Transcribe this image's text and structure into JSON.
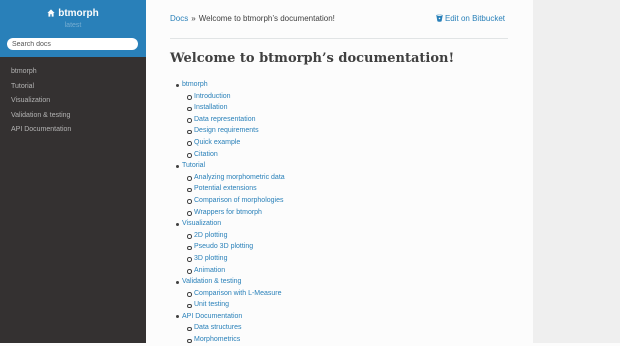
{
  "sidebar": {
    "project": "btmorph",
    "version": "latest",
    "search_placeholder": "Search docs",
    "nav": [
      "btmorph",
      "Tutorial",
      "Visualization",
      "Validation & testing",
      "API Documentation"
    ]
  },
  "header": {
    "breadcrumb_home": "Docs",
    "breadcrumb_separator": "»",
    "breadcrumb_current": "Welcome to btmorph’s documentation!",
    "edit_link": "Edit on Bitbucket"
  },
  "page": {
    "title": "Welcome to btmorph’s documentation!",
    "toc": [
      {
        "label": "btmorph",
        "children": [
          "Introduction",
          "Installation",
          "Data representation",
          "Design requirements",
          "Quick example",
          "Citation"
        ]
      },
      {
        "label": "Tutorial",
        "children": [
          "Analyzing morphometric data",
          "Potential extensions",
          "Comparison of morphologies",
          "Wrappers for btmorph"
        ]
      },
      {
        "label": "Visualization",
        "children": [
          "2D plotting",
          "Pseudo 3D plotting",
          "3D plotting",
          "Animation"
        ]
      },
      {
        "label": "Validation & testing",
        "children": [
          "Comparison with L-Measure",
          "Unit testing"
        ]
      },
      {
        "label": "API Documentation",
        "children": [
          "Data structures",
          "Morphometrics"
        ]
      }
    ]
  },
  "colors": {
    "sidebar_bg": "#343131",
    "header_bg": "#2980b9",
    "link": "#2980b9",
    "text": "#404040"
  }
}
